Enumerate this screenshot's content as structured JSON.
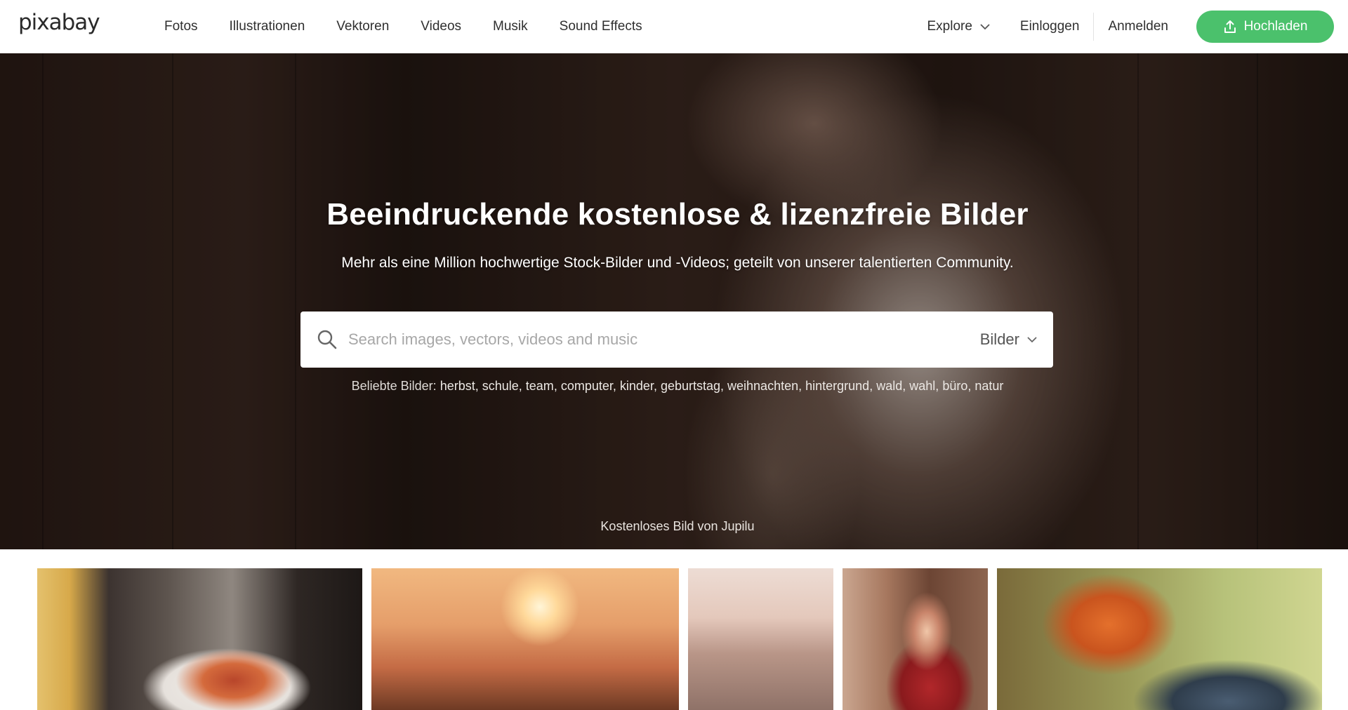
{
  "header": {
    "logo": "pixabay",
    "nav": [
      "Fotos",
      "Illustrationen",
      "Vektoren",
      "Videos",
      "Musik",
      "Sound Effects"
    ],
    "explore_label": "Explore",
    "login_label": "Einloggen",
    "signup_label": "Anmelden",
    "upload_label": "Hochladen",
    "accent_color": "#4bc16c"
  },
  "hero": {
    "title": "Beeindruckende kostenlose & lizenzfreie Bilder",
    "subtitle": "Mehr als eine Million hochwertige Stock-Bilder und -Videos; geteilt von unserer talentierten Community.",
    "search": {
      "placeholder": "Search images, vectors, videos and music",
      "value": "",
      "type_selected": "Bilder"
    },
    "popular_label": "Beliebte Bilder:",
    "popular_tags": [
      "herbst",
      "schule",
      "team",
      "computer",
      "kinder",
      "geburtstag",
      "weihnachten",
      "hintergrund",
      "wald",
      "wahl",
      "büro",
      "natur"
    ],
    "credit": "Kostenloses Bild von Jupilu"
  },
  "icons": {
    "search": "search-icon",
    "explore_chevron": "chevron-down-icon",
    "type_chevron": "chevron-down-icon",
    "upload": "upload-icon"
  }
}
